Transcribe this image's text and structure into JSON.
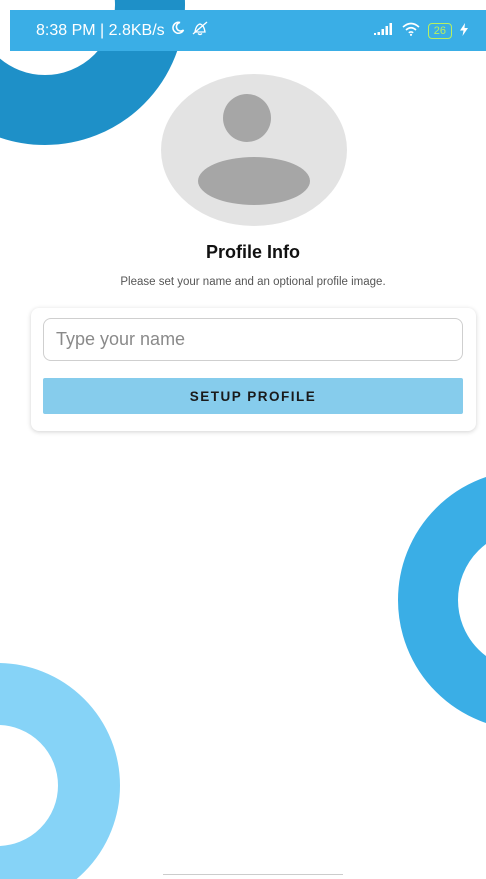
{
  "status_bar": {
    "time_info": "8:38 PM | 2.8KB/s",
    "moon_icon": "crescent-moon",
    "mute_icon": "notification-off",
    "signal_icon": "signal-bars",
    "wifi_icon": "wifi",
    "battery_level": "26",
    "charging_icon": "lightning-bolt"
  },
  "profile": {
    "avatar_icon": "default-person",
    "title": "Profile Info",
    "subtitle": "Please set your name and an optional profile image."
  },
  "form": {
    "name_placeholder": "Type your name",
    "name_value": "",
    "setup_button_label": "SETUP PROFILE"
  },
  "colors": {
    "status_bar": "#3aaee6",
    "ring_dark": "#1e90c8",
    "ring_mid": "#3aaee6",
    "ring_light": "#86d3f7",
    "button": "#86ccec",
    "avatar_bg": "#e3e3e3",
    "avatar_fg": "#a6a6a6"
  }
}
